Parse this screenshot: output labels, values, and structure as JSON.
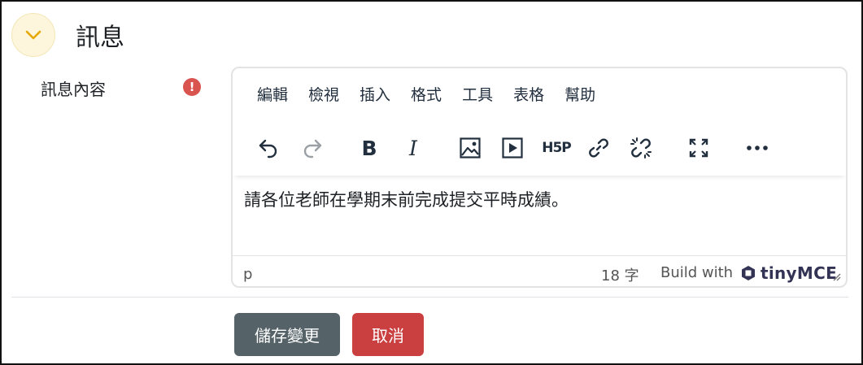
{
  "section": {
    "title": "訊息",
    "collapse_icon": "chevron-down-icon"
  },
  "field": {
    "label": "訊息內容",
    "required_icon_text": "!"
  },
  "editor": {
    "menu": [
      "編輯",
      "檢視",
      "插入",
      "格式",
      "工具",
      "表格",
      "幫助"
    ],
    "toolbar": [
      "undo-icon",
      "redo-icon",
      "bold-icon",
      "italic-icon",
      "image-icon",
      "media-icon",
      "h5p-icon",
      "link-icon",
      "unlink-icon",
      "fullscreen-icon",
      "more-icon"
    ],
    "bold_label": "B",
    "italic_label": "I",
    "h5p_label": "H5P",
    "content": "請各位老師在學期末前完成提交平時成績。",
    "status": {
      "path": "p",
      "word_count": "18 字",
      "build_with": "Build with",
      "brand": "tinyMCE"
    }
  },
  "buttons": {
    "save": "儲存變更",
    "cancel": "取消"
  },
  "colors": {
    "save_bg": "#556268",
    "cancel_bg": "#ca3f3f",
    "required": "#d9534f",
    "collapse_bg": "#fdf6dc",
    "chevron": "#e6a700"
  }
}
